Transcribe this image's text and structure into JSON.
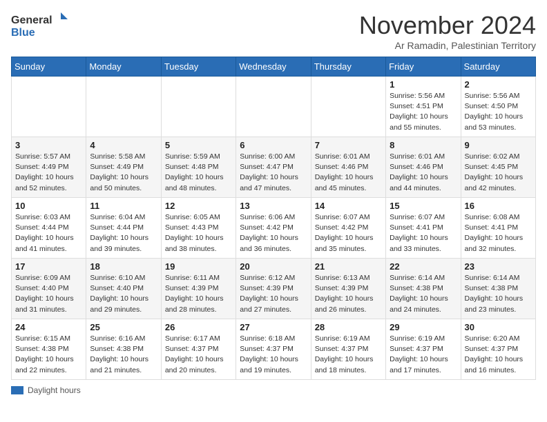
{
  "logo": {
    "text_general": "General",
    "text_blue": "Blue"
  },
  "title": "November 2024",
  "subtitle": "Ar Ramadin, Palestinian Territory",
  "columns": [
    "Sunday",
    "Monday",
    "Tuesday",
    "Wednesday",
    "Thursday",
    "Friday",
    "Saturday"
  ],
  "legend_label": "Daylight hours",
  "weeks": [
    {
      "days": [
        {
          "num": "",
          "info": ""
        },
        {
          "num": "",
          "info": ""
        },
        {
          "num": "",
          "info": ""
        },
        {
          "num": "",
          "info": ""
        },
        {
          "num": "",
          "info": ""
        },
        {
          "num": "1",
          "info": "Sunrise: 5:56 AM\nSunset: 4:51 PM\nDaylight: 10 hours\nand 55 minutes."
        },
        {
          "num": "2",
          "info": "Sunrise: 5:56 AM\nSunset: 4:50 PM\nDaylight: 10 hours\nand 53 minutes."
        }
      ]
    },
    {
      "days": [
        {
          "num": "3",
          "info": "Sunrise: 5:57 AM\nSunset: 4:49 PM\nDaylight: 10 hours\nand 52 minutes."
        },
        {
          "num": "4",
          "info": "Sunrise: 5:58 AM\nSunset: 4:49 PM\nDaylight: 10 hours\nand 50 minutes."
        },
        {
          "num": "5",
          "info": "Sunrise: 5:59 AM\nSunset: 4:48 PM\nDaylight: 10 hours\nand 48 minutes."
        },
        {
          "num": "6",
          "info": "Sunrise: 6:00 AM\nSunset: 4:47 PM\nDaylight: 10 hours\nand 47 minutes."
        },
        {
          "num": "7",
          "info": "Sunrise: 6:01 AM\nSunset: 4:46 PM\nDaylight: 10 hours\nand 45 minutes."
        },
        {
          "num": "8",
          "info": "Sunrise: 6:01 AM\nSunset: 4:46 PM\nDaylight: 10 hours\nand 44 minutes."
        },
        {
          "num": "9",
          "info": "Sunrise: 6:02 AM\nSunset: 4:45 PM\nDaylight: 10 hours\nand 42 minutes."
        }
      ]
    },
    {
      "days": [
        {
          "num": "10",
          "info": "Sunrise: 6:03 AM\nSunset: 4:44 PM\nDaylight: 10 hours\nand 41 minutes."
        },
        {
          "num": "11",
          "info": "Sunrise: 6:04 AM\nSunset: 4:44 PM\nDaylight: 10 hours\nand 39 minutes."
        },
        {
          "num": "12",
          "info": "Sunrise: 6:05 AM\nSunset: 4:43 PM\nDaylight: 10 hours\nand 38 minutes."
        },
        {
          "num": "13",
          "info": "Sunrise: 6:06 AM\nSunset: 4:42 PM\nDaylight: 10 hours\nand 36 minutes."
        },
        {
          "num": "14",
          "info": "Sunrise: 6:07 AM\nSunset: 4:42 PM\nDaylight: 10 hours\nand 35 minutes."
        },
        {
          "num": "15",
          "info": "Sunrise: 6:07 AM\nSunset: 4:41 PM\nDaylight: 10 hours\nand 33 minutes."
        },
        {
          "num": "16",
          "info": "Sunrise: 6:08 AM\nSunset: 4:41 PM\nDaylight: 10 hours\nand 32 minutes."
        }
      ]
    },
    {
      "days": [
        {
          "num": "17",
          "info": "Sunrise: 6:09 AM\nSunset: 4:40 PM\nDaylight: 10 hours\nand 31 minutes."
        },
        {
          "num": "18",
          "info": "Sunrise: 6:10 AM\nSunset: 4:40 PM\nDaylight: 10 hours\nand 29 minutes."
        },
        {
          "num": "19",
          "info": "Sunrise: 6:11 AM\nSunset: 4:39 PM\nDaylight: 10 hours\nand 28 minutes."
        },
        {
          "num": "20",
          "info": "Sunrise: 6:12 AM\nSunset: 4:39 PM\nDaylight: 10 hours\nand 27 minutes."
        },
        {
          "num": "21",
          "info": "Sunrise: 6:13 AM\nSunset: 4:39 PM\nDaylight: 10 hours\nand 26 minutes."
        },
        {
          "num": "22",
          "info": "Sunrise: 6:14 AM\nSunset: 4:38 PM\nDaylight: 10 hours\nand 24 minutes."
        },
        {
          "num": "23",
          "info": "Sunrise: 6:14 AM\nSunset: 4:38 PM\nDaylight: 10 hours\nand 23 minutes."
        }
      ]
    },
    {
      "days": [
        {
          "num": "24",
          "info": "Sunrise: 6:15 AM\nSunset: 4:38 PM\nDaylight: 10 hours\nand 22 minutes."
        },
        {
          "num": "25",
          "info": "Sunrise: 6:16 AM\nSunset: 4:38 PM\nDaylight: 10 hours\nand 21 minutes."
        },
        {
          "num": "26",
          "info": "Sunrise: 6:17 AM\nSunset: 4:37 PM\nDaylight: 10 hours\nand 20 minutes."
        },
        {
          "num": "27",
          "info": "Sunrise: 6:18 AM\nSunset: 4:37 PM\nDaylight: 10 hours\nand 19 minutes."
        },
        {
          "num": "28",
          "info": "Sunrise: 6:19 AM\nSunset: 4:37 PM\nDaylight: 10 hours\nand 18 minutes."
        },
        {
          "num": "29",
          "info": "Sunrise: 6:19 AM\nSunset: 4:37 PM\nDaylight: 10 hours\nand 17 minutes."
        },
        {
          "num": "30",
          "info": "Sunrise: 6:20 AM\nSunset: 4:37 PM\nDaylight: 10 hours\nand 16 minutes."
        }
      ]
    }
  ]
}
